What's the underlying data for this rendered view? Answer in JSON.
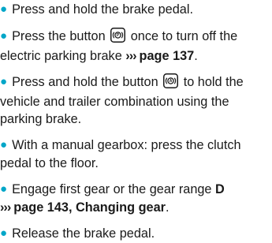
{
  "steps": [
    {
      "text": "Press and hold the brake pedal."
    },
    {
      "pre": "Press the button",
      "post": "once to turn off the electric parking brake",
      "ref_arrows": "›››",
      "ref_text": "page 137",
      "end": ".",
      "icon": "parking-brake-button-icon"
    },
    {
      "pre": "Press and hold the button",
      "post": "to hold the vehicle and trailer combination using the parking brake.",
      "icon": "auto-hold-button-icon"
    },
    {
      "text": "With a manual gearbox: press the clutch pedal to the floor."
    },
    {
      "pre": "Engage first gear or the gear range",
      "gear": "D",
      "ref_arrows": "›››",
      "ref_text": "page 143, Changing gear",
      "end": "."
    },
    {
      "text": "Release the brake pedal."
    }
  ],
  "colors": {
    "bullet": "#00a6c8",
    "text": "#1a1a1a"
  }
}
